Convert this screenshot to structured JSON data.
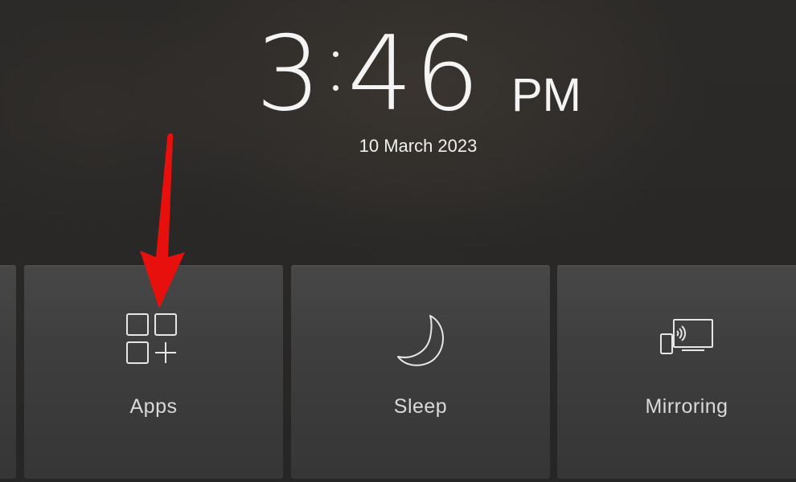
{
  "clock": {
    "hour": "3",
    "minutes": "46",
    "ampm": "PM",
    "date": "10 March 2023"
  },
  "tiles": [
    {
      "label": "Apps",
      "icon": "apps-grid-plus-icon"
    },
    {
      "label": "Sleep",
      "icon": "moon-icon"
    },
    {
      "label": "Mirroring",
      "icon": "screen-mirroring-icon"
    }
  ],
  "colors": {
    "background": "#2b2a29",
    "tile": "#3f3f3f",
    "text": "#f4f4f4",
    "tile_label": "#d9d9d9",
    "arrow": "#e8100c"
  }
}
